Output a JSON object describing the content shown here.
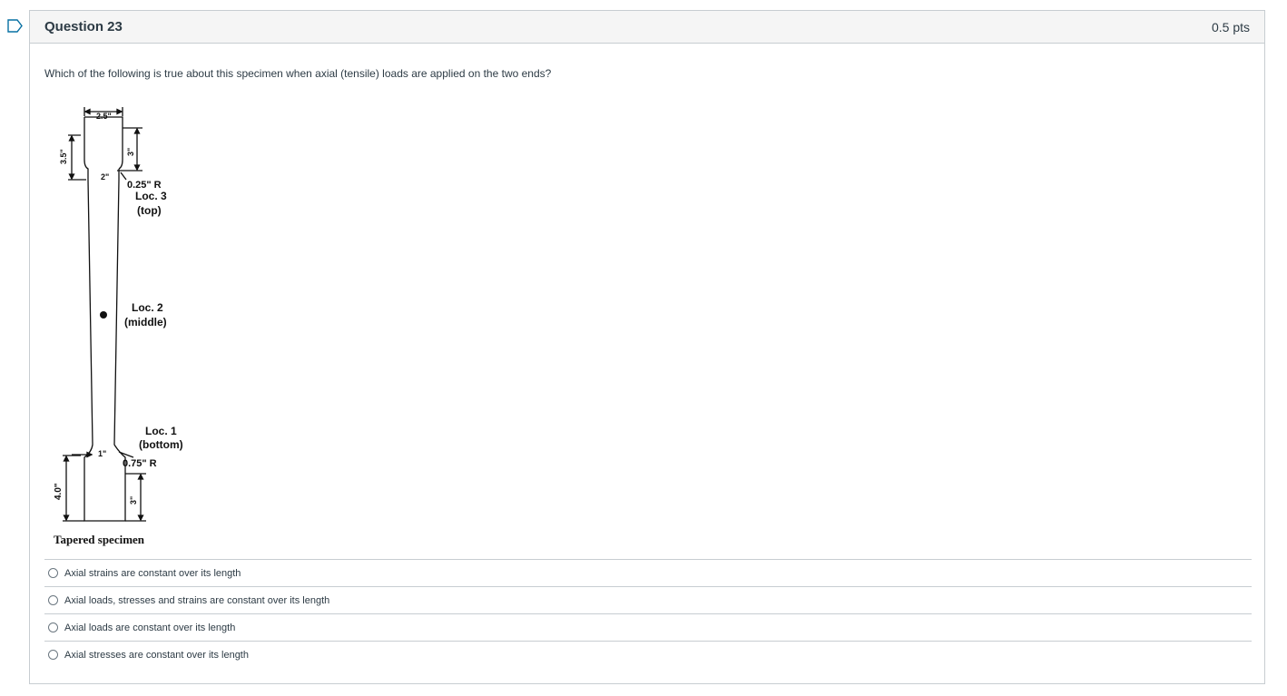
{
  "question": {
    "title": "Question 23",
    "points": "0.5 pts",
    "text": "Which of the following is true about this specimen when axial (tensile) loads are applied on the two ends?"
  },
  "figure": {
    "dim_top_width": "2.5\"",
    "dim_top_height": "3.5\"",
    "dim_top_grip": "3\"",
    "dim_neck_top": "2\"",
    "radius_top": "0.25\" R",
    "loc3_name": "Loc. 3",
    "loc3_pos": "(top)",
    "loc2_name": "Loc. 2",
    "loc2_pos": "(middle)",
    "loc1_name": "Loc. 1",
    "loc1_pos": "(bottom)",
    "dim_neck_bottom": "1\"",
    "radius_bottom": "0.75\" R",
    "dim_bottom_height": "4.0\"",
    "dim_bottom_grip": "3\"",
    "caption": "Tapered specimen"
  },
  "answers": [
    {
      "label": "Axial strains are constant over its length"
    },
    {
      "label": "Axial loads, stresses and strains are constant over its length"
    },
    {
      "label": "Axial loads are constant over its length"
    },
    {
      "label": "Axial stresses are constant over its length"
    }
  ]
}
